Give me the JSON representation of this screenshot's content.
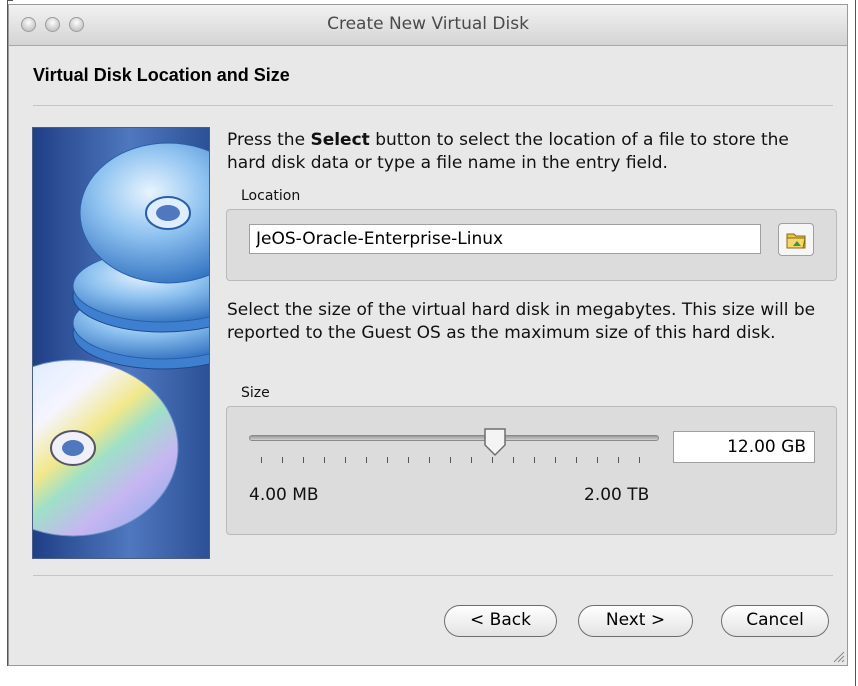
{
  "window": {
    "title": "Create New Virtual Disk"
  },
  "page": {
    "heading": "Virtual Disk Location and Size"
  },
  "location": {
    "description_before": "Press the ",
    "description_bold": "Select",
    "description_after": " button to select the location of a file to store the hard disk data or type a file name in the entry field.",
    "group_label": "Location",
    "value": "JeOS-Oracle-Enterprise-Linux",
    "select_icon": "folder-icon"
  },
  "size": {
    "description": "Select the size of the virtual hard disk in megabytes. This size will be reported to the Guest OS as the maximum size of this hard disk.",
    "group_label": "Size",
    "value": "12.00 GB",
    "min_label": "4.00 MB",
    "max_label": "2.00 TB",
    "slider_fraction": 0.6
  },
  "buttons": {
    "back": "< Back",
    "next": "Next >",
    "cancel": "Cancel"
  }
}
